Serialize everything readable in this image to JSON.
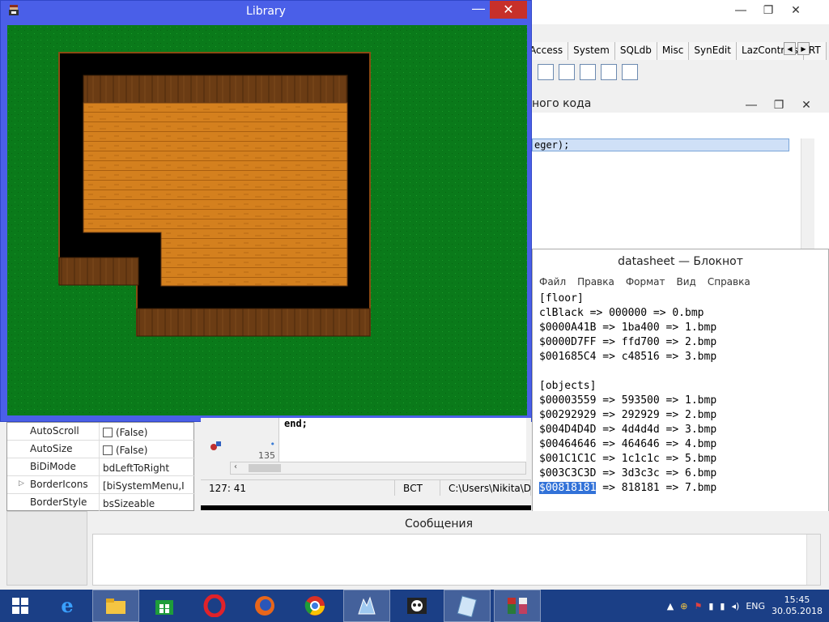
{
  "game_window": {
    "title": "Library"
  },
  "component_palette": {
    "tabs": [
      "Access",
      "System",
      "SQLdb",
      "Misc",
      "SynEdit",
      "LazControls",
      "RT"
    ]
  },
  "messages_window": {
    "title": "ного кода",
    "code_line": "eger);"
  },
  "object_inspector": {
    "rows": [
      {
        "name": "AutoScroll",
        "value": "(False)",
        "has_checkbox": true
      },
      {
        "name": "AutoSize",
        "value": "(False)",
        "has_checkbox": true
      },
      {
        "name": "BiDiMode",
        "value": "bdLeftToRight",
        "has_checkbox": false
      },
      {
        "name": "BorderIcons",
        "value": "[biSystemMenu,I",
        "has_checkbox": false
      },
      {
        "name": "BorderStyle",
        "value": "bsSizeable",
        "has_checkbox": false
      }
    ]
  },
  "editor": {
    "code_text": "end;",
    "line_number": "135",
    "status": {
      "position": "127: 41",
      "mode": "ВСТ",
      "path": "C:\\Users\\Nikita\\D"
    }
  },
  "notepad": {
    "title": "datasheet — Блокнот",
    "menu": [
      "Файл",
      "Правка",
      "Формат",
      "Вид",
      "Справка"
    ],
    "lines": [
      "[floor]",
      "clBlack => 000000 => 0.bmp",
      "$0000A41B => 1ba400 => 1.bmp",
      "$0000D7FF => ffd700 => 2.bmp",
      "$001685C4 => c48516 => 3.bmp",
      "",
      "[objects]",
      "$00003559 => 593500 => 1.bmp",
      "$00292929 => 292929 => 2.bmp",
      "$004D4D4D => 4d4d4d => 3.bmp",
      "$00464646 => 464646 => 4.bmp",
      "$001C1C1C => 1c1c1c => 5.bmp",
      "$003C3C3D => 3d3c3c => 6.bmp"
    ],
    "selected_token": "$00818181",
    "last_line_rest": " => 818181 => 7.bmp"
  },
  "messages_panel": {
    "title": "Сообщения"
  },
  "taskbar": {
    "apps": [
      "start",
      "internet-explorer",
      "file-explorer",
      "store",
      "opera",
      "firefox",
      "chrome",
      "lazarus",
      "kingsoft",
      "notepad",
      "game"
    ],
    "tray": {
      "language": "ENG",
      "time": "15:45",
      "date": "30.05.2018"
    }
  },
  "colors": {
    "game_frame": "#4a5fe8",
    "grass": "#0a7a1a",
    "floor": "#d4801e",
    "wall": "#6b3c14",
    "taskbar": "#1b3f86",
    "selection": "#3272d8"
  }
}
